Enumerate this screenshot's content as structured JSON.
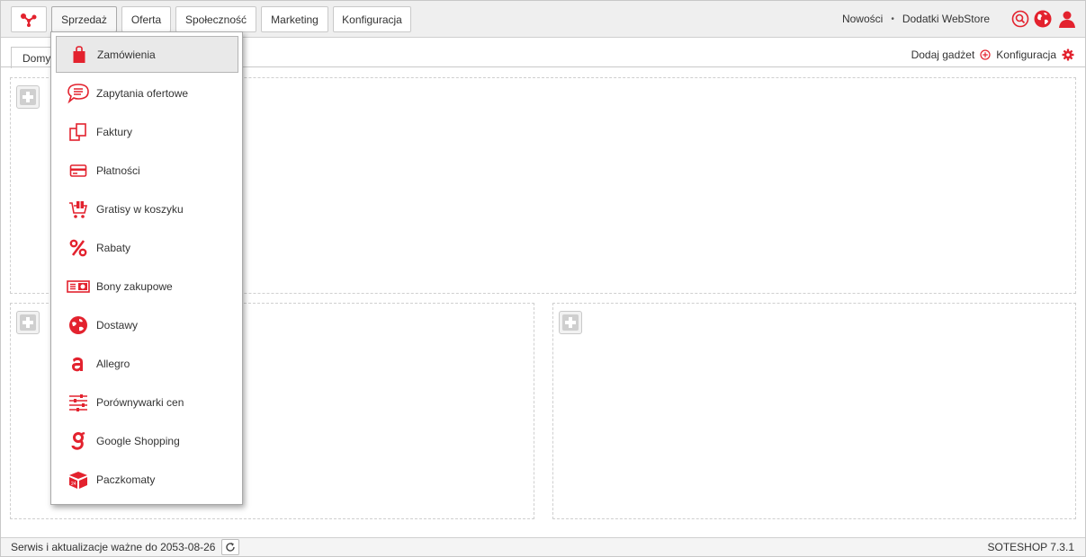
{
  "colors": {
    "accent": "#e3222e",
    "text": "#333333"
  },
  "topbar": {
    "logo_icon": "share-nodes-logo-icon",
    "tabs": [
      {
        "label": "Sprzedaż",
        "active": true
      },
      {
        "label": "Oferta",
        "active": false
      },
      {
        "label": "Społeczność",
        "active": false
      },
      {
        "label": "Marketing",
        "active": false
      },
      {
        "label": "Konfiguracja",
        "active": false
      }
    ],
    "right_links": {
      "news": "Nowości",
      "separator": "•",
      "webstore": "Dodatki WebStore"
    },
    "right_icons": [
      "search-icon",
      "globe-icon",
      "user-icon"
    ]
  },
  "subbar": {
    "home_tab": "Domy",
    "add_gadget": "Dodaj gadżet",
    "config": "Konfiguracja"
  },
  "dropdown": {
    "items": [
      {
        "label": "Zamówienia",
        "icon": "shopping-bag-icon",
        "selected": true
      },
      {
        "label": "Zapytania ofertowe",
        "icon": "chat-bubble-icon",
        "selected": false
      },
      {
        "label": "Faktury",
        "icon": "documents-icon",
        "selected": false
      },
      {
        "label": "Płatności",
        "icon": "credit-card-icon",
        "selected": false
      },
      {
        "label": "Gratisy w koszyku",
        "icon": "gift-cart-icon",
        "selected": false
      },
      {
        "label": "Rabaty",
        "icon": "percent-icon",
        "selected": false
      },
      {
        "label": "Bony zakupowe",
        "icon": "voucher-icon",
        "selected": false
      },
      {
        "label": "Dostawy",
        "icon": "globe-delivery-icon",
        "selected": false
      },
      {
        "label": "Allegro",
        "icon": "allegro-icon",
        "selected": false
      },
      {
        "label": "Porównywarki cen",
        "icon": "sliders-icon",
        "selected": false
      },
      {
        "label": "Google Shopping",
        "icon": "google-g-icon",
        "selected": false
      },
      {
        "label": "Paczkomaty",
        "icon": "parcel-box-icon",
        "selected": false
      }
    ]
  },
  "footer": {
    "service_text": "Serwis i aktualizacje ważne do 2053-08-26",
    "version": "SOTESHOP 7.3.1"
  }
}
